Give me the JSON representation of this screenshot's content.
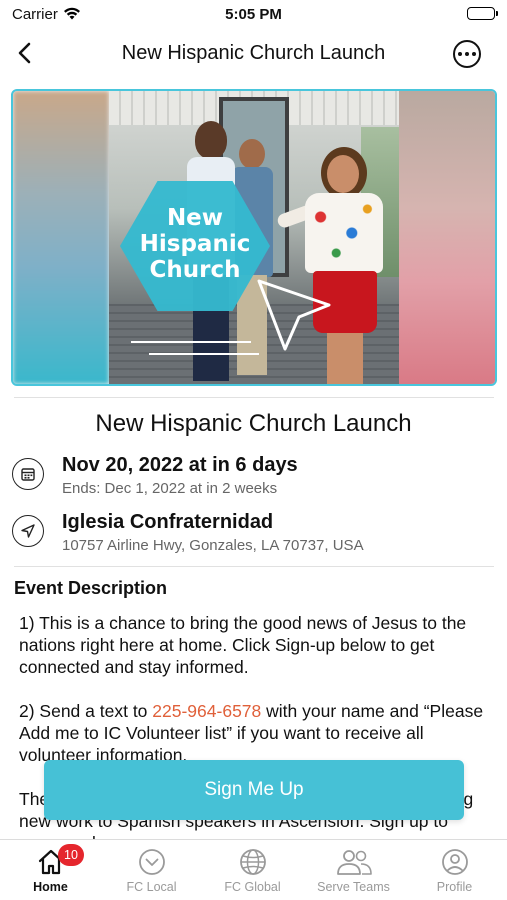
{
  "status_bar": {
    "carrier": "Carrier",
    "time": "5:05 PM"
  },
  "nav": {
    "title": "New Hispanic Church Launch",
    "back_icon": "chevron-left-icon",
    "more_icon": "more-horizontal-circle-icon"
  },
  "banner": {
    "hex_text_line1": "New",
    "hex_text_line2": "Hispanic",
    "hex_text_line3": "Church",
    "accent_color": "#49c6dc"
  },
  "event": {
    "title": "New Hispanic Church Launch",
    "date_main": "Nov 20, 2022 at in 6 days",
    "date_sub": "Ends: Dec 1, 2022 at in 2 weeks",
    "date_icon": "calendar-icon",
    "location_main": "Iglesia Confraternidad",
    "location_sub": "10757 Airline Hwy, Gonzales, LA 70737, USA",
    "location_icon": "location-arrow-icon"
  },
  "description": {
    "heading": "Event Description",
    "para1": "1) This is a chance to bring the good news of Jesus  to the nations right here at home.  Click Sign-up below to get connected and stay informed.",
    "para2_prefix": "2) Send a text to ",
    "para2_phone": "225-964-6578",
    "para2_suffix": " with your name and “Please Add me to IC Volunteer list” if you want to receive all volunteer information.",
    "para3": "There are multiple opportunities to be a part of an amazing new work to Spanish speakers in Ascension. Sign up to serve and"
  },
  "signup_button": {
    "label": "Sign Me Up",
    "color": "#46c1d6"
  },
  "tab_bar": {
    "tabs": [
      {
        "label": "Home",
        "icon": "home-icon",
        "active": true,
        "badge": "10"
      },
      {
        "label": "FC Local",
        "icon": "chevron-down-circle-icon",
        "active": false
      },
      {
        "label": "FC Global",
        "icon": "globe-icon",
        "active": false
      },
      {
        "label": "Serve Teams",
        "icon": "people-icon",
        "active": false
      },
      {
        "label": "Profile",
        "icon": "profile-icon",
        "active": false
      }
    ]
  }
}
